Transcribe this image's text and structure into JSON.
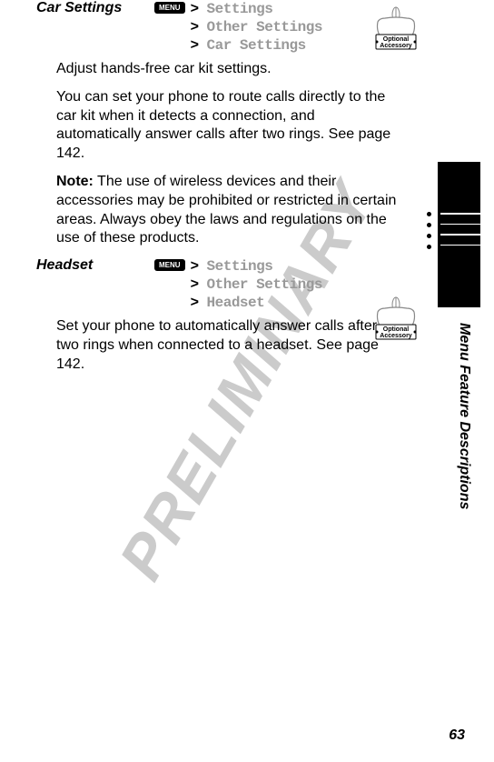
{
  "watermark": "PRELIMINARY",
  "sideLabel": "Menu Feature Descriptions",
  "pageNumber": "63",
  "menuKeyLabel": "MENU",
  "accessoryBadge": {
    "line1": "Optional",
    "line2": "Accessory"
  },
  "sections": {
    "carSettings": {
      "title": "Car Settings",
      "path": {
        "l1": "Settings",
        "l2": "Other Settings",
        "l3": "Car Settings"
      },
      "body1": "Adjust hands-free car kit settings.",
      "body2": "You can set your phone to route calls directly to the car kit when it detects a connection, and automatically answer calls after two rings. See page 142.",
      "noteLabel": "Note:",
      "noteBody": " The use of wireless devices and their accessories may be prohibited or restricted in certain areas. Always obey the laws and regulations on the use of these products."
    },
    "headset": {
      "title": "Headset",
      "path": {
        "l1": "Settings",
        "l2": "Other Settings",
        "l3": "Headset"
      },
      "body1": "Set your phone to automatically answer calls after two rings when connected to a headset. See page 142."
    }
  }
}
